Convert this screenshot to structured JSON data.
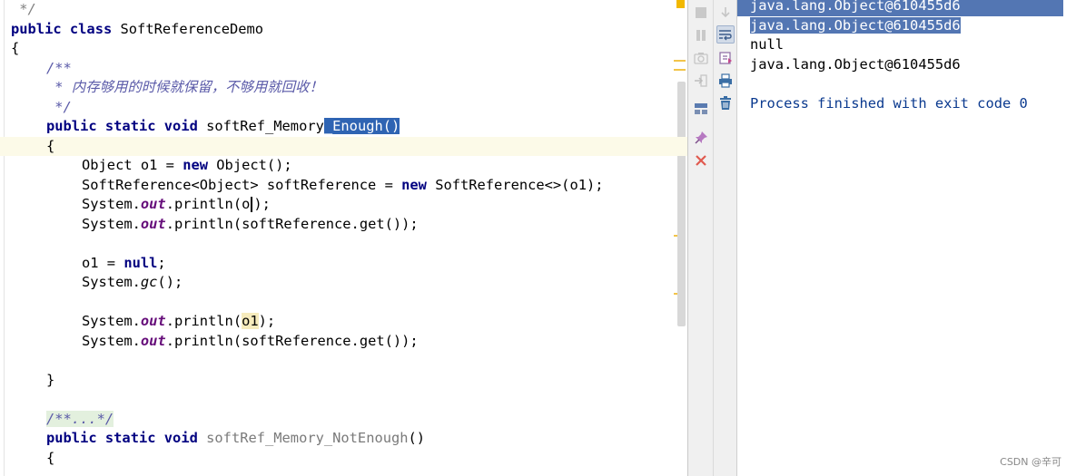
{
  "editor": {
    "lines": [
      " */",
      "public class SoftReferenceDemo",
      "{",
      "/**",
      " * 内存够用的时候就保留，不够用就回收！",
      " */",
      "public static void softRef_Memory_Enough()",
      "{",
      "Object o1 = new Object();",
      "SoftReference<Object> softReference = new SoftReference<>(o1);",
      "System.out.println(o1);",
      "System.out.println(softReference.get());",
      "",
      "o1 = null;",
      "System.gc();",
      "",
      "System.out.println(o1);",
      "System.out.println(softReference.get());",
      "",
      "}",
      "",
      "/**...*/",
      "public static void softRef_Memory_NotEnough()",
      "{"
    ],
    "tokens": {
      "public": "public",
      "class": "class",
      "static": "static",
      "void": "void",
      "new": "new",
      "null": "null",
      "class_name": "SoftReferenceDemo",
      "open_brace": "{",
      "close_brace": "}",
      "doc_open": "/**",
      "doc_text": " * 内存够用的时候就保留，不够用就回收！",
      "doc_close": " */",
      "doc_close_top": " */",
      "method1_prefix": "softRef_Memory",
      "method1_selected": "_Enough()",
      "obj_decl_a": "Object o1 = ",
      "obj_decl_b": " Object();",
      "softref_decl_a": "SoftReference<Object> softReference = ",
      "softref_decl_b": " SoftReference<>(o1);",
      "system": "System.",
      "out": "out",
      "println_open": ".println(",
      "o1_partial": "o",
      "o1_tail": ");",
      "softref_get": "softReference.get());",
      "o1_assign_a": "o1 = ",
      "semicolon": ";",
      "gc": "gc",
      "gc_tail": "();",
      "o1": "o1",
      "folded_doc": "/**...*/",
      "method2_name": "softRef_Memory_NotEnough",
      "parens": "()"
    }
  },
  "toolbar": {
    "icons_left": [
      "stop-icon",
      "pause-icon",
      "camera-icon",
      "exit-icon",
      "layout-icon",
      "pin-icon",
      "close-icon"
    ],
    "icons_right": [
      "scroll-down-icon",
      "soft-wrap-icon",
      "scroll-to-end-icon",
      "print-icon",
      "trash-icon"
    ]
  },
  "console": {
    "lines": [
      "java.lang.Object@610455d6",
      "java.lang.Object@610455d6",
      "null",
      "java.lang.Object@610455d6",
      "",
      "Process finished with exit code 0"
    ]
  },
  "watermark": "CSDN @辛可",
  "colors": {
    "keyword": "#000080",
    "selection": "#2f64b3",
    "console_selection": "#5376b3",
    "current_line": "#fcfae8"
  }
}
